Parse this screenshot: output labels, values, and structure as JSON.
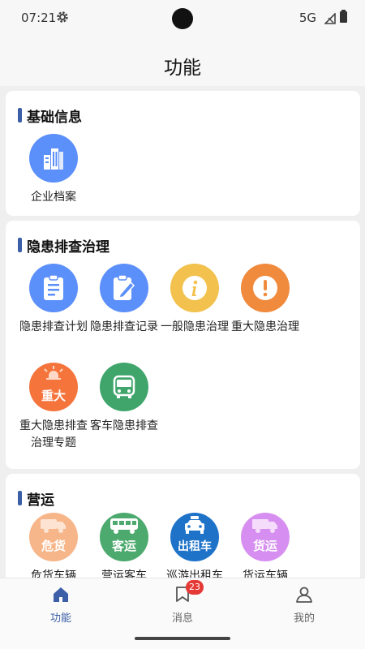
{
  "status": {
    "time": "07:21",
    "network": "5G"
  },
  "header": {
    "title": "功能"
  },
  "sections": [
    {
      "title": "基础信息",
      "items": [
        {
          "label": "企业档案",
          "icon": "building-icon",
          "color": "#5b8ff9"
        }
      ]
    },
    {
      "title": "隐患排查治理",
      "items": [
        {
          "label": "隐患排查计划",
          "icon": "clipboard-icon",
          "color": "#5b8ff9"
        },
        {
          "label": "隐患排查记录",
          "icon": "edit-record-icon",
          "color": "#5b8ff9"
        },
        {
          "label": "一般隐患治理",
          "icon": "info-icon",
          "color": "#f2c14e"
        },
        {
          "label": "重大隐患治理",
          "icon": "alert-icon",
          "color": "#f08a3c"
        },
        {
          "label": "重大隐患排查治理专题",
          "icon": "siren-icon",
          "color": "#f5743b",
          "badge": "重大"
        },
        {
          "label": "客车隐患排查",
          "icon": "bus-front-icon",
          "color": "#3fa56b"
        }
      ]
    },
    {
      "title": "营运",
      "items": [
        {
          "label": "危货车辆",
          "icon": "hazmat-truck-icon",
          "color": "#f7b68a",
          "badge": "危货"
        },
        {
          "label": "营运客车",
          "icon": "coach-icon",
          "color": "#4caa6e",
          "badge": "客运"
        },
        {
          "label": "巡游出租车",
          "icon": "taxi-icon",
          "color": "#1e73c9",
          "badge": "出租车"
        },
        {
          "label": "货运车辆",
          "icon": "truck-icon",
          "color": "#d68ff0",
          "badge": "货运"
        }
      ]
    }
  ],
  "tabbar": {
    "tabs": [
      {
        "label": "功能",
        "icon": "home-icon",
        "active": true
      },
      {
        "label": "消息",
        "icon": "message-icon",
        "badge": "23"
      },
      {
        "label": "我的",
        "icon": "user-icon"
      }
    ]
  },
  "colors": {
    "accent": "#3c5fa7",
    "badge_red": "#e53935"
  }
}
